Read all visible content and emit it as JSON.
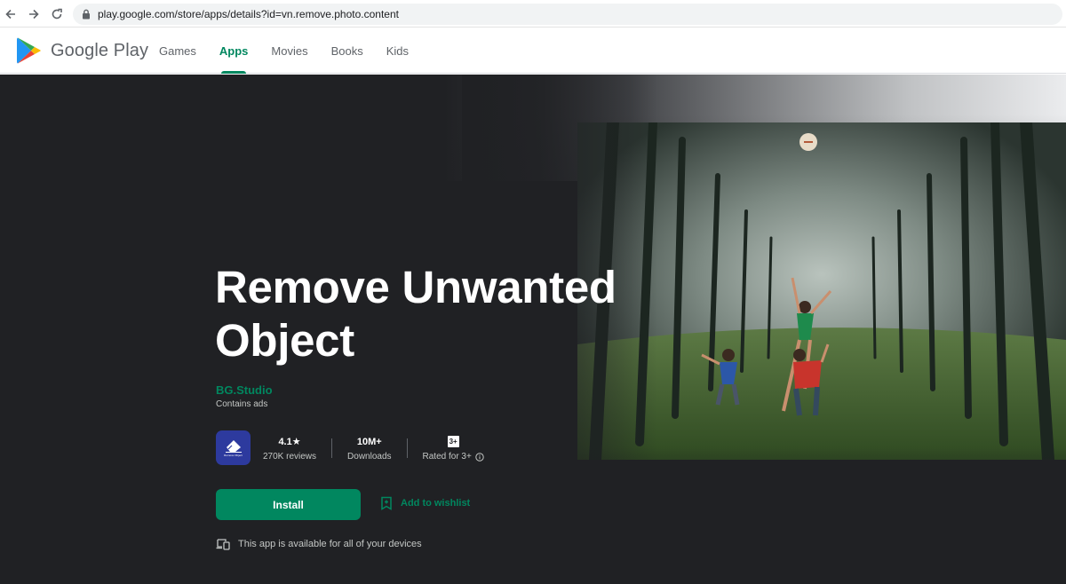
{
  "browser": {
    "url": "play.google.com/store/apps/details?id=vn.remove.photo.content",
    "icons": {
      "back": "arrow-left-icon",
      "forward": "arrow-right-icon",
      "reload": "reload-icon",
      "lock": "lock-icon"
    }
  },
  "header": {
    "logo_text": "Google Play",
    "nav": [
      {
        "label": "Games",
        "active": false
      },
      {
        "label": "Apps",
        "active": true
      },
      {
        "label": "Movies",
        "active": false
      },
      {
        "label": "Books",
        "active": false
      },
      {
        "label": "Kids",
        "active": false
      }
    ]
  },
  "app": {
    "title_line1": "Remove Unwanted",
    "title_line2": "Object",
    "developer": "BG.Studio",
    "ads_notice": "Contains ads",
    "icon_label": "Remove Object",
    "stats": {
      "rating": "4.1★",
      "reviews": "270K reviews",
      "downloads": "10M+",
      "downloads_label": "Downloads",
      "content_rating_badge": "3+",
      "content_rating_label": "Rated for 3+"
    },
    "install_label": "Install",
    "wishlist_label": "Add to wishlist",
    "devices_notice": "This app is available for all of your devices"
  },
  "colors": {
    "accent": "#01875f",
    "hero_bg": "#202124",
    "app_icon_bg": "#2d3a9e"
  }
}
